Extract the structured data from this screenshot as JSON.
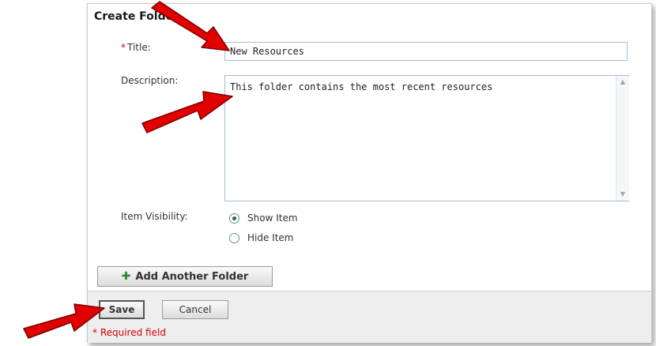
{
  "dialog": {
    "title": "Create Folder"
  },
  "form": {
    "title_label": "Title:",
    "title_required_mark": "*",
    "title_value": "New Resources",
    "description_label": "Description:",
    "description_value": "This folder contains the most recent resources",
    "visibility_label": "Item Visibility:",
    "visibility_options": [
      {
        "label": "Show Item",
        "selected": true
      },
      {
        "label": "Hide Item",
        "selected": false
      }
    ]
  },
  "actions": {
    "add_another_label": "Add Another Folder",
    "add_another_icon": "plus-icon",
    "save_label": "Save",
    "cancel_label": "Cancel"
  },
  "footer": {
    "required_note": "* Required field"
  },
  "colors": {
    "required": "#d40000",
    "annotation_arrow": "#e00000",
    "plus_icon": "#2e8b2e"
  }
}
